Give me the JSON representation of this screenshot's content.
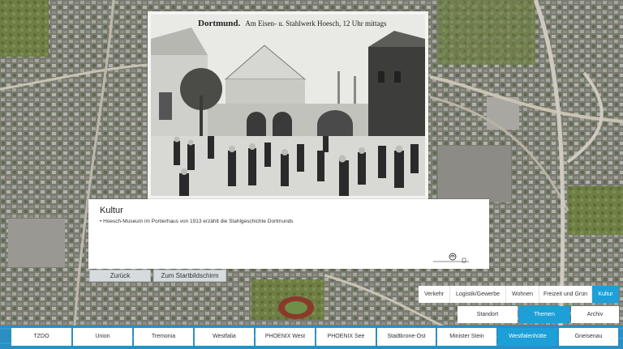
{
  "photo": {
    "caption_city": "Dortmund.",
    "caption_text": "Am Eisen- u. Stahlwerk Hoesch, 12 Uhr mittags"
  },
  "info": {
    "title": "Kultur",
    "text": "• Hoesch-Museum im Portierhaus von 1913 erzählt die Stahlgeschichte Dortmunds",
    "back_label": "Zurück",
    "home_label": "Zum Startbildschirm"
  },
  "categories": [
    {
      "label": "Verkehr",
      "active": false
    },
    {
      "label": "Logistik/Gewerbe",
      "active": false
    },
    {
      "label": "Wohnen",
      "active": false
    },
    {
      "label": "Freizeit und Grün",
      "active": false
    },
    {
      "label": "Kultur",
      "active": true
    }
  ],
  "modes": [
    {
      "label": "Standort",
      "active": false
    },
    {
      "label": "Themen",
      "active": true
    },
    {
      "label": "Archiv",
      "active": false
    }
  ],
  "locations": [
    {
      "label": "TZDO",
      "active": false
    },
    {
      "label": "Union",
      "active": false
    },
    {
      "label": "Tremonia",
      "active": false
    },
    {
      "label": "Westfalia",
      "active": false
    },
    {
      "label": "PHOENIX West",
      "active": false
    },
    {
      "label": "PHOENIX See",
      "active": false
    },
    {
      "label": "Stadtkrone-Ost",
      "active": false
    },
    {
      "label": "Minister Stein",
      "active": false
    },
    {
      "label": "Westfalenhütte",
      "active": true
    },
    {
      "label": "Gneisenau",
      "active": false
    }
  ],
  "colors": {
    "accent": "#1d9fd8",
    "bar": "#2a8fc2"
  },
  "icons": {
    "swipe": "swipe-hand-icon"
  }
}
